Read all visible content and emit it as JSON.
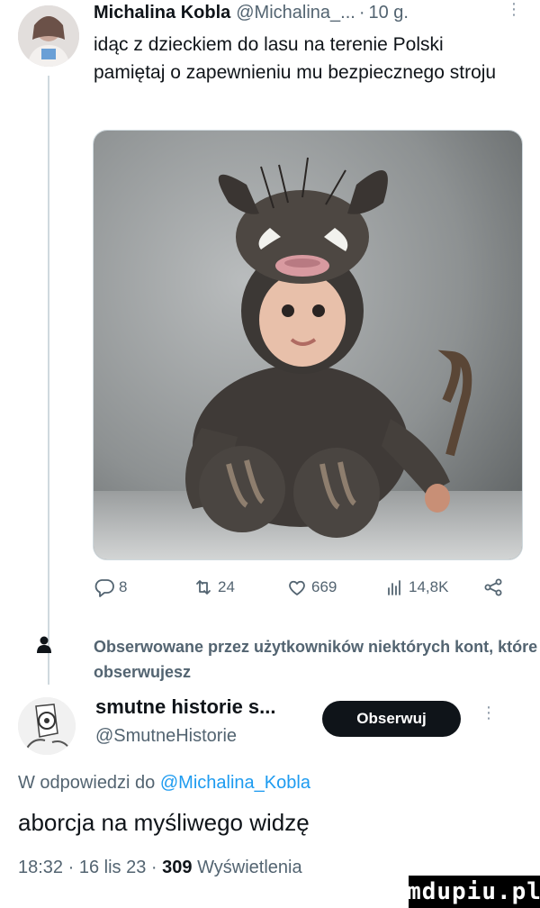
{
  "tweet": {
    "display_name": "Michalina Kobla",
    "handle": "@Michalina_...",
    "separator": "·",
    "time": "10 g.",
    "text": "idąc z dzieckiem do lasu na terenie Polski pamiętaj o zapewnieniu mu bezpiecznego stroju",
    "media_kind": "photo",
    "stats": {
      "replies": "8",
      "retweets": "24",
      "likes": "669",
      "views": "14,8K"
    }
  },
  "notice": {
    "text": "Obserwowane przez użytkowników niektórych kont, które obserwujesz"
  },
  "suggestion": {
    "name": "smutne historie s...",
    "handle": "@SmutneHistorie",
    "follow_label": "Obserwuj"
  },
  "reply": {
    "prefix": "W odpowiedzi do ",
    "mention": "@Michalina_Kobla",
    "text": "aborcja na myśliwego widzę",
    "time": "18:32",
    "date": "16 lis 23",
    "views_count": "309",
    "views_label": "Wyświetlenia"
  },
  "watermark": "mdupiu.pl",
  "icons": {
    "reply": "reply-icon",
    "retweet": "retweet-icon",
    "like": "heart-icon",
    "views": "views-icon",
    "share": "share-icon",
    "notice": "person-icon"
  },
  "colors": {
    "text": "#0f1419",
    "muted": "#536471",
    "link": "#1d9bf0",
    "button": "#0f1419"
  }
}
